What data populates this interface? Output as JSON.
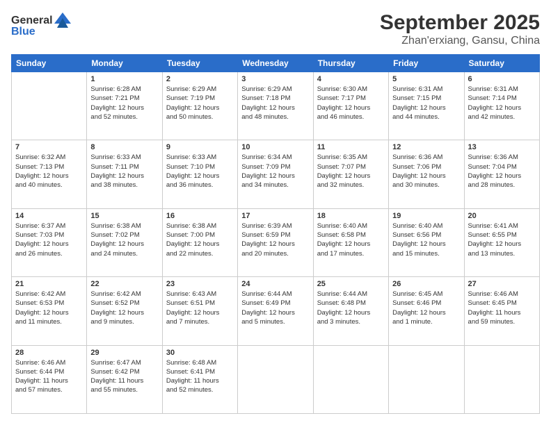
{
  "logo": {
    "line1": "General",
    "line2": "Blue"
  },
  "title": "September 2025",
  "subtitle": "Zhan'erxiang, Gansu, China",
  "days_of_week": [
    "Sunday",
    "Monday",
    "Tuesday",
    "Wednesday",
    "Thursday",
    "Friday",
    "Saturday"
  ],
  "weeks": [
    [
      {
        "day": "",
        "info": ""
      },
      {
        "day": "1",
        "info": "Sunrise: 6:28 AM\nSunset: 7:21 PM\nDaylight: 12 hours\nand 52 minutes."
      },
      {
        "day": "2",
        "info": "Sunrise: 6:29 AM\nSunset: 7:19 PM\nDaylight: 12 hours\nand 50 minutes."
      },
      {
        "day": "3",
        "info": "Sunrise: 6:29 AM\nSunset: 7:18 PM\nDaylight: 12 hours\nand 48 minutes."
      },
      {
        "day": "4",
        "info": "Sunrise: 6:30 AM\nSunset: 7:17 PM\nDaylight: 12 hours\nand 46 minutes."
      },
      {
        "day": "5",
        "info": "Sunrise: 6:31 AM\nSunset: 7:15 PM\nDaylight: 12 hours\nand 44 minutes."
      },
      {
        "day": "6",
        "info": "Sunrise: 6:31 AM\nSunset: 7:14 PM\nDaylight: 12 hours\nand 42 minutes."
      }
    ],
    [
      {
        "day": "7",
        "info": "Sunrise: 6:32 AM\nSunset: 7:13 PM\nDaylight: 12 hours\nand 40 minutes."
      },
      {
        "day": "8",
        "info": "Sunrise: 6:33 AM\nSunset: 7:11 PM\nDaylight: 12 hours\nand 38 minutes."
      },
      {
        "day": "9",
        "info": "Sunrise: 6:33 AM\nSunset: 7:10 PM\nDaylight: 12 hours\nand 36 minutes."
      },
      {
        "day": "10",
        "info": "Sunrise: 6:34 AM\nSunset: 7:09 PM\nDaylight: 12 hours\nand 34 minutes."
      },
      {
        "day": "11",
        "info": "Sunrise: 6:35 AM\nSunset: 7:07 PM\nDaylight: 12 hours\nand 32 minutes."
      },
      {
        "day": "12",
        "info": "Sunrise: 6:36 AM\nSunset: 7:06 PM\nDaylight: 12 hours\nand 30 minutes."
      },
      {
        "day": "13",
        "info": "Sunrise: 6:36 AM\nSunset: 7:04 PM\nDaylight: 12 hours\nand 28 minutes."
      }
    ],
    [
      {
        "day": "14",
        "info": "Sunrise: 6:37 AM\nSunset: 7:03 PM\nDaylight: 12 hours\nand 26 minutes."
      },
      {
        "day": "15",
        "info": "Sunrise: 6:38 AM\nSunset: 7:02 PM\nDaylight: 12 hours\nand 24 minutes."
      },
      {
        "day": "16",
        "info": "Sunrise: 6:38 AM\nSunset: 7:00 PM\nDaylight: 12 hours\nand 22 minutes."
      },
      {
        "day": "17",
        "info": "Sunrise: 6:39 AM\nSunset: 6:59 PM\nDaylight: 12 hours\nand 20 minutes."
      },
      {
        "day": "18",
        "info": "Sunrise: 6:40 AM\nSunset: 6:58 PM\nDaylight: 12 hours\nand 17 minutes."
      },
      {
        "day": "19",
        "info": "Sunrise: 6:40 AM\nSunset: 6:56 PM\nDaylight: 12 hours\nand 15 minutes."
      },
      {
        "day": "20",
        "info": "Sunrise: 6:41 AM\nSunset: 6:55 PM\nDaylight: 12 hours\nand 13 minutes."
      }
    ],
    [
      {
        "day": "21",
        "info": "Sunrise: 6:42 AM\nSunset: 6:53 PM\nDaylight: 12 hours\nand 11 minutes."
      },
      {
        "day": "22",
        "info": "Sunrise: 6:42 AM\nSunset: 6:52 PM\nDaylight: 12 hours\nand 9 minutes."
      },
      {
        "day": "23",
        "info": "Sunrise: 6:43 AM\nSunset: 6:51 PM\nDaylight: 12 hours\nand 7 minutes."
      },
      {
        "day": "24",
        "info": "Sunrise: 6:44 AM\nSunset: 6:49 PM\nDaylight: 12 hours\nand 5 minutes."
      },
      {
        "day": "25",
        "info": "Sunrise: 6:44 AM\nSunset: 6:48 PM\nDaylight: 12 hours\nand 3 minutes."
      },
      {
        "day": "26",
        "info": "Sunrise: 6:45 AM\nSunset: 6:46 PM\nDaylight: 12 hours\nand 1 minute."
      },
      {
        "day": "27",
        "info": "Sunrise: 6:46 AM\nSunset: 6:45 PM\nDaylight: 11 hours\nand 59 minutes."
      }
    ],
    [
      {
        "day": "28",
        "info": "Sunrise: 6:46 AM\nSunset: 6:44 PM\nDaylight: 11 hours\nand 57 minutes."
      },
      {
        "day": "29",
        "info": "Sunrise: 6:47 AM\nSunset: 6:42 PM\nDaylight: 11 hours\nand 55 minutes."
      },
      {
        "day": "30",
        "info": "Sunrise: 6:48 AM\nSunset: 6:41 PM\nDaylight: 11 hours\nand 52 minutes."
      },
      {
        "day": "",
        "info": ""
      },
      {
        "day": "",
        "info": ""
      },
      {
        "day": "",
        "info": ""
      },
      {
        "day": "",
        "info": ""
      }
    ]
  ]
}
